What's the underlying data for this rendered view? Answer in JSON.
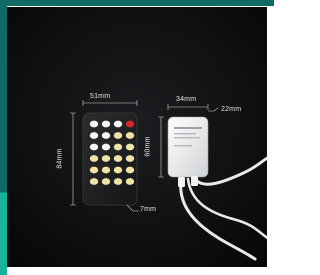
{
  "dimensions": {
    "remote_width": "51mm",
    "remote_height": "84mm",
    "remote_depth": "7mm",
    "controller_width": "34mm",
    "controller_depth": "22mm",
    "controller_height": "60mm"
  },
  "colors": {
    "background": "#0d0e10",
    "accent_teal": "#0e6a63",
    "accent_green": "#18b39c",
    "dimension_line": "#cfcfcf",
    "warm_button": "#f0e3a8",
    "cool_button": "#f5f5f5",
    "red_button": "#d9262b",
    "remote_body": "#222324",
    "controller_body": "#f2f3f4"
  },
  "icons": [
    "remote-control-icon",
    "led-controller-icon",
    "cable-icon"
  ]
}
